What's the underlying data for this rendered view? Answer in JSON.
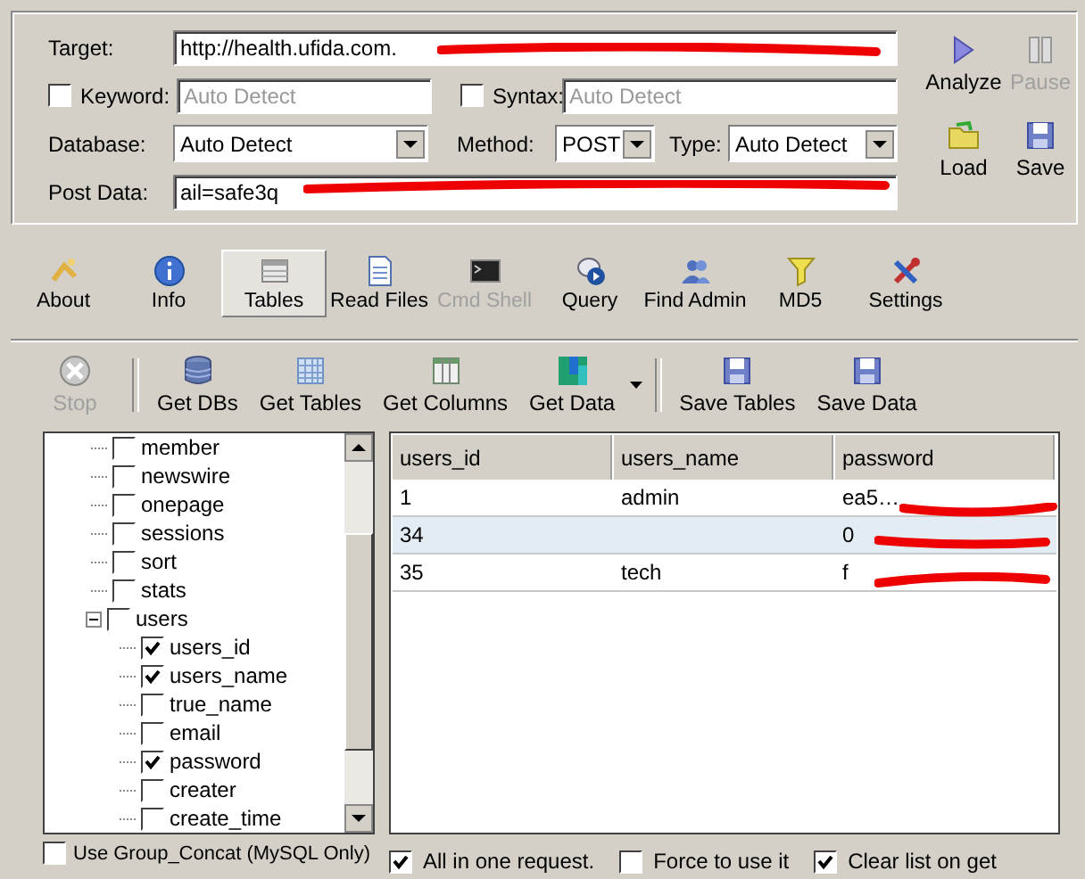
{
  "form": {
    "target": {
      "label": "Target:",
      "value": "http://health.ufida.com."
    },
    "keyword": {
      "label": "Keyword:",
      "checked": false,
      "placeholder": "Auto Detect"
    },
    "syntax": {
      "label": "Syntax:",
      "checked": false,
      "placeholder": "Auto Detect"
    },
    "database": {
      "label": "Database:",
      "value": "Auto Detect"
    },
    "method": {
      "label": "Method:",
      "value": "POST"
    },
    "type": {
      "label": "Type:",
      "value": "Auto Detect"
    },
    "post_data": {
      "label": "Post Data:",
      "value": "ail=safe3q"
    }
  },
  "actions": [
    {
      "kind": "analyze",
      "label": "Analyze",
      "disabled": false
    },
    {
      "kind": "pause",
      "label": "Pause",
      "disabled": true
    },
    {
      "kind": "load",
      "label": "Load",
      "disabled": false
    },
    {
      "kind": "save",
      "label": "Save",
      "disabled": false
    }
  ],
  "tabs": [
    {
      "kind": "about",
      "label": "About",
      "selected": false,
      "disabled": false
    },
    {
      "kind": "info",
      "label": "Info",
      "selected": false,
      "disabled": false
    },
    {
      "kind": "tables",
      "label": "Tables",
      "selected": true,
      "disabled": false
    },
    {
      "kind": "file",
      "label": "Read Files",
      "selected": false,
      "disabled": false
    },
    {
      "kind": "shell",
      "label": "Cmd Shell",
      "selected": false,
      "disabled": true
    },
    {
      "kind": "query",
      "label": "Query",
      "selected": false,
      "disabled": false
    },
    {
      "kind": "admin",
      "label": "Find Admin",
      "selected": false,
      "disabled": false
    },
    {
      "kind": "md5",
      "label": "MD5",
      "selected": false,
      "disabled": false
    },
    {
      "kind": "settings",
      "label": "Settings",
      "selected": false,
      "disabled": false
    }
  ],
  "toolbar": [
    [
      {
        "kind": "stop",
        "label": "Stop",
        "disabled": true
      }
    ],
    [
      {
        "kind": "dbs",
        "label": "Get DBs",
        "disabled": false
      },
      {
        "kind": "tables",
        "label": "Get Tables",
        "disabled": false
      },
      {
        "kind": "columns",
        "label": "Get Columns",
        "disabled": false
      },
      {
        "kind": "data",
        "label": "Get Data",
        "disabled": false,
        "dropdown": true
      }
    ],
    [
      {
        "kind": "save",
        "label": "Save Tables",
        "disabled": false
      },
      {
        "kind": "save",
        "label": "Save Data",
        "disabled": false
      }
    ]
  ],
  "tree": [
    {
      "label": "member",
      "checked": false
    },
    {
      "label": "newswire",
      "checked": false
    },
    {
      "label": "onepage",
      "checked": false
    },
    {
      "label": "sessions",
      "checked": false
    },
    {
      "label": "sort",
      "checked": false
    },
    {
      "label": "stats",
      "checked": false
    },
    {
      "label": "users",
      "checked": false,
      "expanded": true,
      "children": [
        {
          "label": "users_id",
          "checked": true
        },
        {
          "label": "users_name",
          "checked": true
        },
        {
          "label": "true_name",
          "checked": false
        },
        {
          "label": "email",
          "checked": false
        },
        {
          "label": "password",
          "checked": true
        },
        {
          "label": "creater",
          "checked": false
        },
        {
          "label": "create_time",
          "checked": false
        }
      ]
    }
  ],
  "tree_option": {
    "label": "Use Group_Concat (MySQL Only)",
    "checked": false
  },
  "grid": {
    "columns": [
      "users_id",
      "users_name",
      "password"
    ],
    "rows": [
      {
        "cells": [
          "1",
          "admin",
          "ea5…"
        ],
        "selected": false
      },
      {
        "cells": [
          "34",
          "",
          "0"
        ],
        "selected": true
      },
      {
        "cells": [
          "35",
          "tech",
          "f"
        ],
        "selected": false
      }
    ]
  },
  "grid_options": [
    {
      "label": "All in one request.",
      "checked": true
    },
    {
      "label": "Force to use it",
      "checked": false
    },
    {
      "label": "Clear list on get",
      "checked": true
    }
  ]
}
